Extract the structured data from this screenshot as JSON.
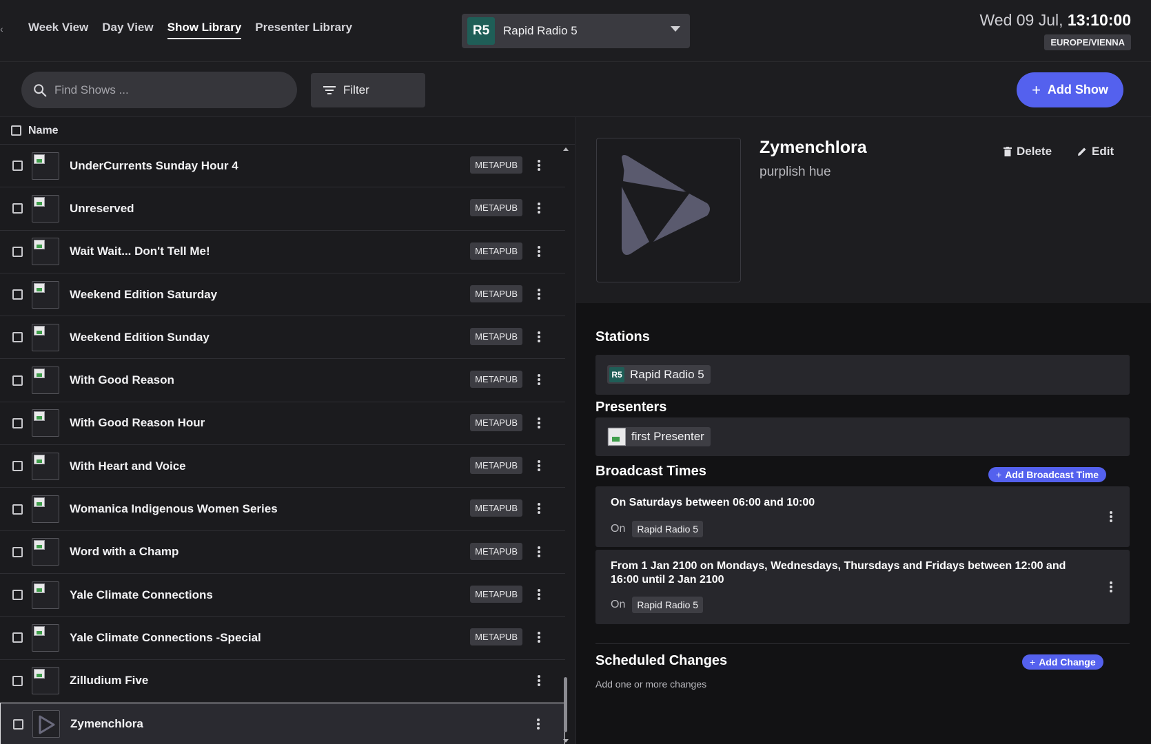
{
  "nav": {
    "tabs": [
      {
        "label": "Week View",
        "active": false
      },
      {
        "label": "Day View",
        "active": false
      },
      {
        "label": "Show Library",
        "active": true
      },
      {
        "label": "Presenter Library",
        "active": false
      }
    ]
  },
  "station_selector": {
    "logo_text": "R5",
    "name": "Rapid Radio 5",
    "logo_color": "#1f5e57"
  },
  "clock": {
    "date": "Wed 09 Jul,",
    "time": "13:10:00",
    "timezone": "EUROPE/VIENNA"
  },
  "toolbar": {
    "search_placeholder": "Find Shows ...",
    "filter_label": "Filter",
    "add_show_label": "Add Show",
    "accent_color": "#5461ee"
  },
  "list": {
    "header": "Name",
    "rows": [
      {
        "name": "UnderCurrents Sunday Hour 4",
        "badge": "METAPUB"
      },
      {
        "name": "Unreserved",
        "badge": "METAPUB"
      },
      {
        "name": "Wait Wait... Don't Tell Me!",
        "badge": "METAPUB"
      },
      {
        "name": "Weekend Edition Saturday",
        "badge": "METAPUB"
      },
      {
        "name": "Weekend Edition Sunday",
        "badge": "METAPUB"
      },
      {
        "name": "With Good Reason",
        "badge": "METAPUB"
      },
      {
        "name": "With Good Reason Hour",
        "badge": "METAPUB"
      },
      {
        "name": "With Heart and Voice",
        "badge": "METAPUB"
      },
      {
        "name": "Womanica Indigenous Women Series",
        "badge": "METAPUB"
      },
      {
        "name": "Word with a Champ",
        "badge": "METAPUB"
      },
      {
        "name": "Yale Climate Connections",
        "badge": "METAPUB"
      },
      {
        "name": "Yale Climate Connections -Special",
        "badge": "METAPUB"
      },
      {
        "name": "Zilludium Five",
        "badge": ""
      },
      {
        "name": "Zymenchlora",
        "badge": "",
        "selected": true
      }
    ]
  },
  "detail": {
    "title": "Zymenchlora",
    "subtitle": "purplish hue",
    "delete_label": "Delete",
    "edit_label": "Edit",
    "stations_title": "Stations",
    "station_chip": {
      "logo_text": "R5",
      "label": "Rapid Radio 5"
    },
    "presenters_title": "Presenters",
    "presenter_chip": {
      "label": "first Presenter"
    },
    "broadcast_title": "Broadcast Times",
    "add_broadcast_label": "Add Broadcast Time",
    "broadcast_times": [
      {
        "text": "On Saturdays between 06:00 and 10:00",
        "on_label": "On",
        "station": "Rapid Radio 5"
      },
      {
        "text": "From 1 Jan 2100 on Mondays, Wednesdays, Thursdays and Fridays between 12:00 and 16:00 until 2 Jan 2100",
        "on_label": "On",
        "station": "Rapid Radio 5"
      }
    ],
    "changes_title": "Scheduled Changes",
    "add_change_label": "Add Change",
    "changes_subtitle": "Add one or more changes"
  }
}
